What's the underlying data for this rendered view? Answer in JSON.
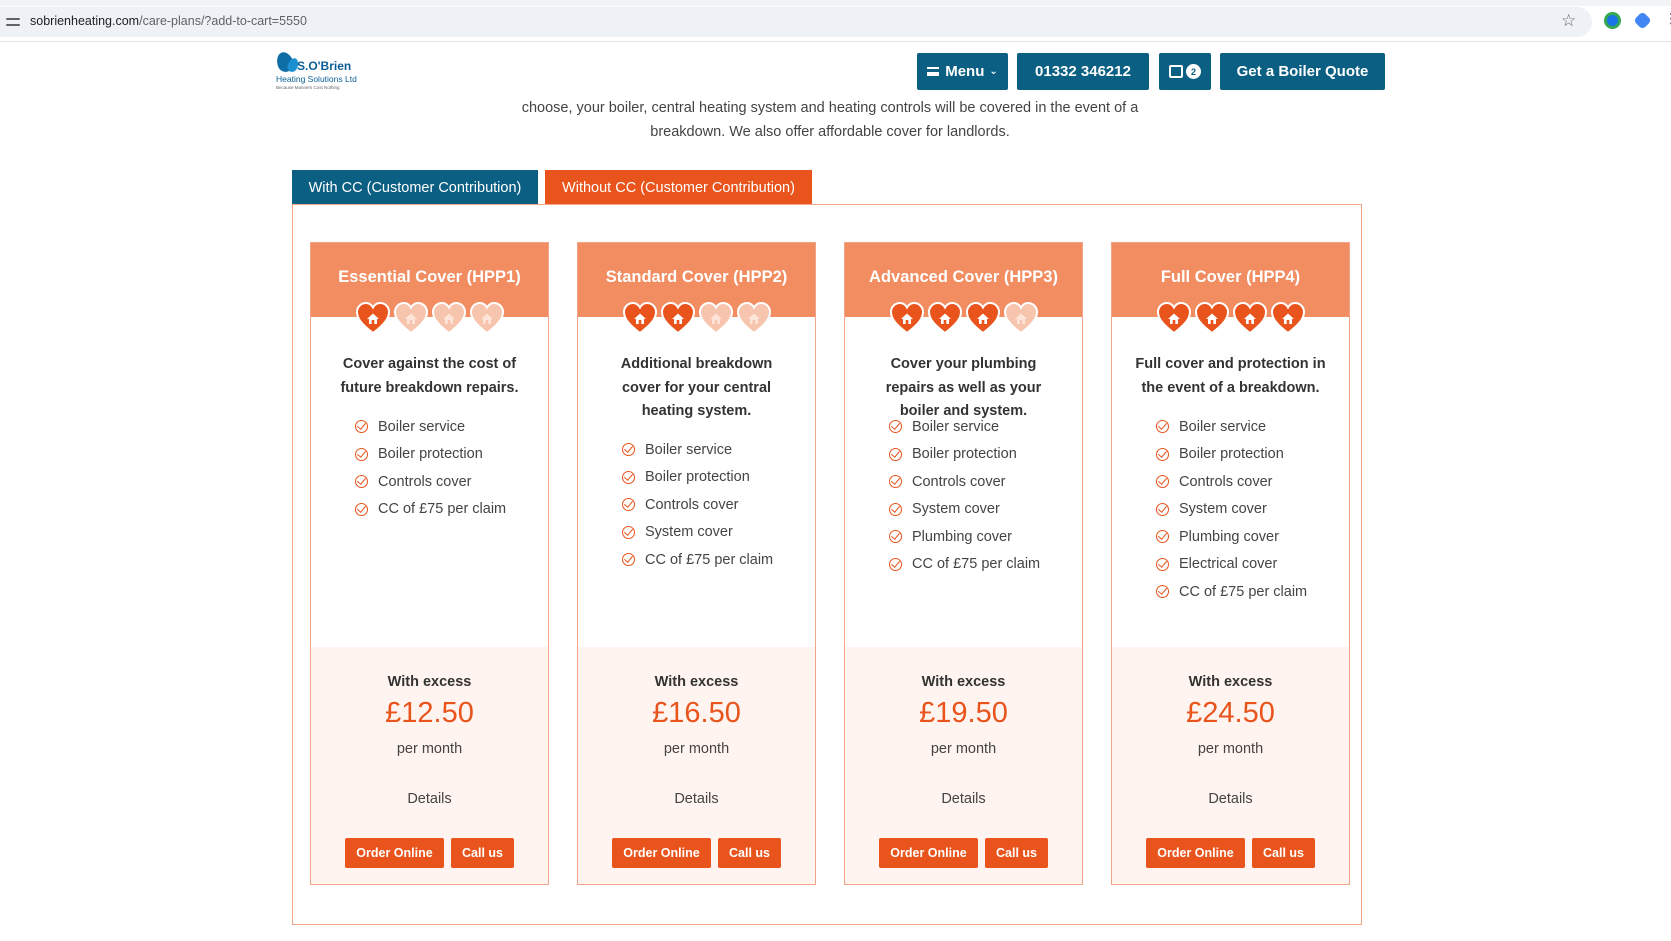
{
  "browser": {
    "url_domain": "sobrienheating.com",
    "url_path": "/care-plans/?add-to-cart=5550"
  },
  "header": {
    "logo_brand": "S.O'Brien",
    "logo_sub": "Heating Solutions Ltd",
    "logo_tag": "Because Manners Cost Nothing",
    "menu_label": "Menu",
    "phone_label": "01332 346212",
    "cart_count": "2",
    "quote_label": "Get a Boiler Quote"
  },
  "intro": {
    "line1": "choose, your boiler, central heating system and heating controls will be covered in the event of a",
    "line2": "breakdown. We also offer affordable cover for landlords."
  },
  "tabs": [
    {
      "label": "With CC (Customer Contribution)",
      "active": false
    },
    {
      "label": "Without CC (Customer Contribution)",
      "active": true
    }
  ],
  "colors": {
    "brand_blue": "#0b5f82",
    "accent_orange": "#e8541c",
    "card_header": "#f28d62",
    "card_footer": "#fff4ef"
  },
  "plans": [
    {
      "title": "Essential Cover (HPP1)",
      "filled_hearts": 1,
      "description": "Cover against the cost of future breakdown repairs.",
      "features": [
        "Boiler service",
        "Boiler protection",
        "Controls cover",
        "CC of £75 per claim"
      ],
      "excess_label": "With excess",
      "price": "£12.50",
      "period": "per month",
      "details": "Details",
      "order_label": "Order Online",
      "call_label": "Call us"
    },
    {
      "title": "Standard Cover (HPP2)",
      "filled_hearts": 2,
      "description": "Additional breakdown cover for your central heating system.",
      "features": [
        "Boiler service",
        "Boiler protection",
        "Controls cover",
        "System cover",
        "CC of £75 per claim"
      ],
      "excess_label": "With excess",
      "price": "£16.50",
      "period": "per month",
      "details": "Details",
      "order_label": "Order Online",
      "call_label": "Call us"
    },
    {
      "title": "Advanced Cover (HPP3)",
      "filled_hearts": 3,
      "description": "Cover your plumbing repairs as well as your boiler and system.",
      "features": [
        "Boiler service",
        "Boiler protection",
        "Controls cover",
        "System cover",
        "Plumbing cover",
        "CC of £75 per claim"
      ],
      "excess_label": "With excess",
      "price": "£19.50",
      "period": "per month",
      "details": "Details",
      "order_label": "Order Online",
      "call_label": "Call us"
    },
    {
      "title": "Full Cover (HPP4)",
      "filled_hearts": 4,
      "description": "Full cover and protection in the event of a breakdown.",
      "features": [
        "Boiler service",
        "Boiler protection",
        "Controls cover",
        "System cover",
        "Plumbing cover",
        "Electrical cover",
        "CC of £75 per claim"
      ],
      "excess_label": "With excess",
      "price": "£24.50",
      "period": "per month",
      "details": "Details",
      "order_label": "Order Online",
      "call_label": "Call us"
    }
  ]
}
